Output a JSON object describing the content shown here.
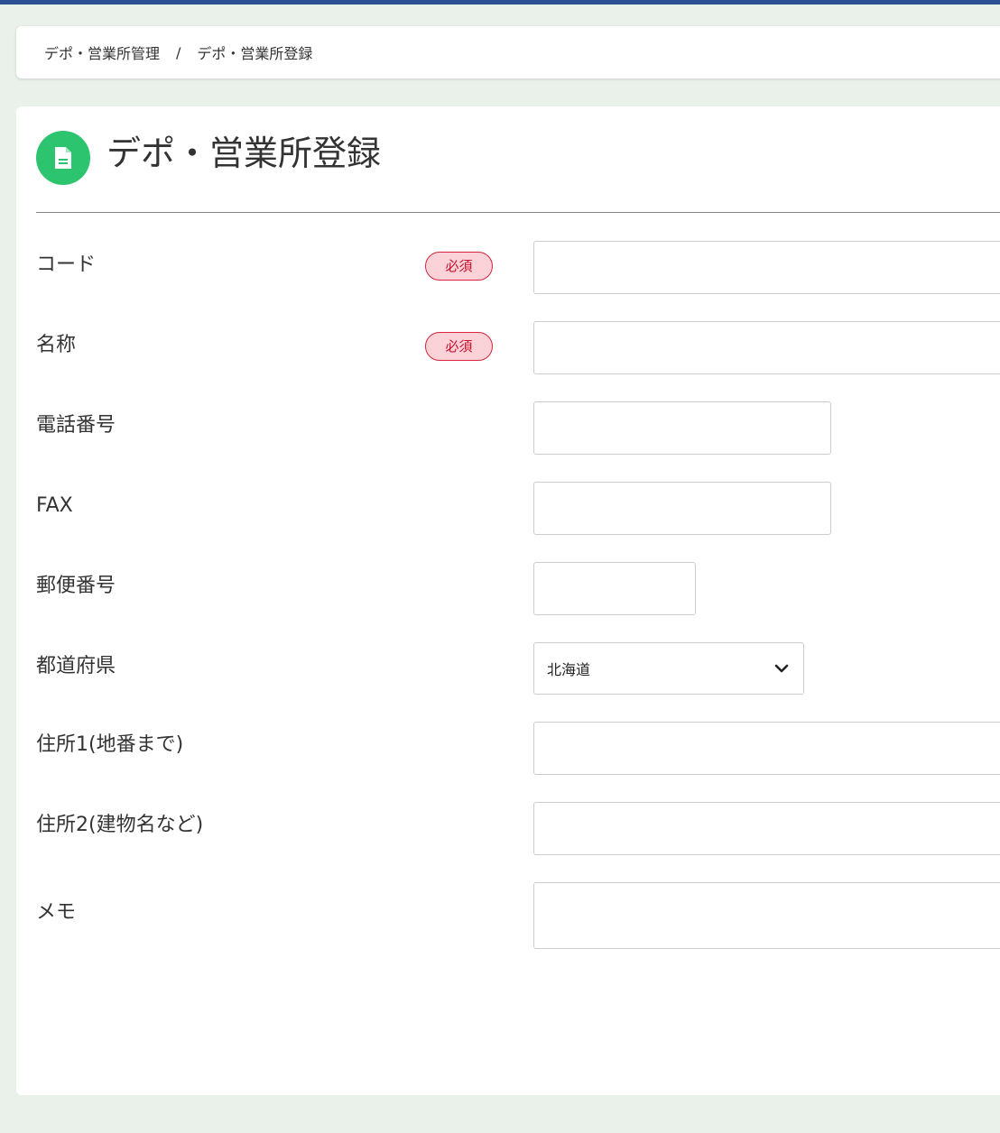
{
  "breadcrumb": {
    "parent": "デポ・営業所管理",
    "separator": "/",
    "current": "デポ・営業所登録"
  },
  "page": {
    "title": "デポ・営業所登録",
    "icon": "document-icon",
    "accent_color": "#2dc46f"
  },
  "form": {
    "required_label": "必須",
    "fields": [
      {
        "label": "コード",
        "required": true,
        "value": ""
      },
      {
        "label": "名称",
        "required": true,
        "value": ""
      },
      {
        "label": "電話番号",
        "required": false,
        "value": ""
      },
      {
        "label": "FAX",
        "required": false,
        "value": ""
      },
      {
        "label": "郵便番号",
        "required": false,
        "value": ""
      },
      {
        "label": "都道府県",
        "required": false,
        "value": "北海道"
      },
      {
        "label": "住所1(地番まで)",
        "required": false,
        "value": ""
      },
      {
        "label": "住所2(建物名など)",
        "required": false,
        "value": ""
      },
      {
        "label": "メモ",
        "required": false,
        "value": ""
      }
    ]
  }
}
